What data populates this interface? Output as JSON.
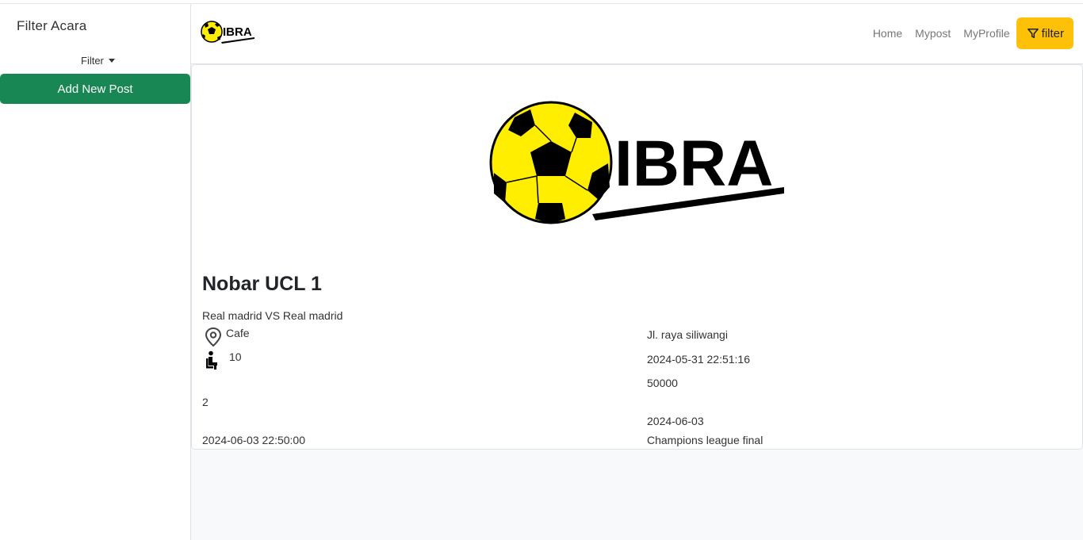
{
  "sidebar": {
    "title": "Filter Acara",
    "filter_label": "Filter",
    "add_button_label": "Add New Post"
  },
  "navbar": {
    "logo_text": "IBRA",
    "links": [
      "Home",
      "Mypost",
      "MyProfile"
    ],
    "filter_button_label": "filter",
    "filter_button_color": "#ffc107"
  },
  "post": {
    "logo_text": "IBRA",
    "title": "Nobar UCL 1",
    "match": "Real madrid VS Real madrid",
    "location_type": "Cafe",
    "seats": "10",
    "value_2": "2",
    "event_datetime": "2024-06-03 22:50:00",
    "address": "Jl. raya siliwangi",
    "created_at": "2024-05-31 22:51:16",
    "price": "50000",
    "event_date": "2024-06-03",
    "description": "Champions league final"
  },
  "colors": {
    "success": "#198754",
    "warning": "#ffc107",
    "logo_ball": "#ffee00"
  },
  "icons": {
    "filter": "funnel-icon",
    "location": "map-pin-icon",
    "seat": "seat-icon"
  }
}
